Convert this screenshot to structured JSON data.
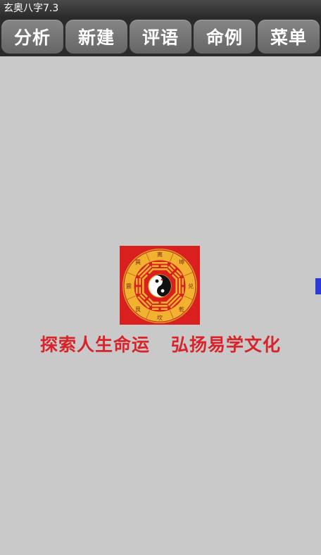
{
  "app": {
    "title": "玄奥八字7.3"
  },
  "toolbar": {
    "tabs": [
      {
        "id": "analyze",
        "label": "分析"
      },
      {
        "id": "new",
        "label": "新建"
      },
      {
        "id": "review",
        "label": "评语"
      },
      {
        "id": "examples",
        "label": "命例"
      },
      {
        "id": "menu",
        "label": "菜单"
      }
    ]
  },
  "splash": {
    "slogan_left": "探索人生命运",
    "slogan_right": "弘扬易学文化",
    "logo_icon": "bagua-yinyang-icon",
    "trigram_labels": [
      "离",
      "坤",
      "兑",
      "乾",
      "坎",
      "艮",
      "震",
      "巽"
    ]
  },
  "colors": {
    "background": "#c9c9c9",
    "slogan": "#d8232a",
    "logo_red": "#d9201f",
    "logo_gold": "#f2b230",
    "handle": "#2b3ad8"
  }
}
